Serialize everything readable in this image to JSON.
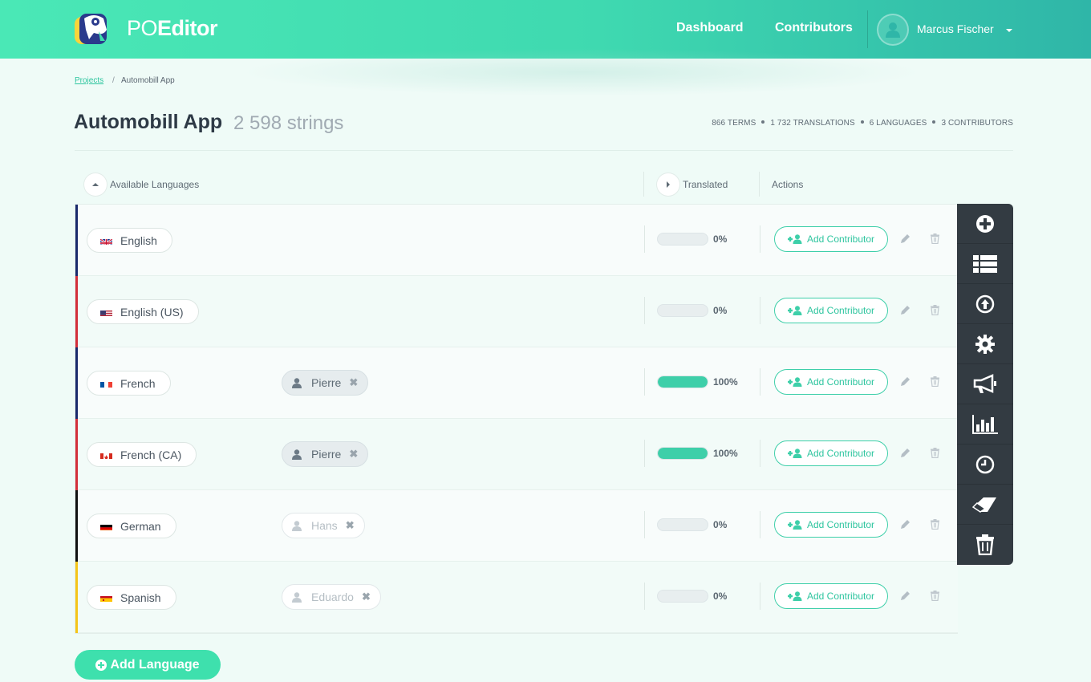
{
  "app": {
    "logo_light": "PO",
    "logo_bold": "Editor"
  },
  "nav": {
    "dashboard": "Dashboard",
    "contributors": "Contributors"
  },
  "user": {
    "name": "Marcus Fischer"
  },
  "breadcrumb": {
    "link": "Projects",
    "separator": "/",
    "current": "Automobill App"
  },
  "project": {
    "title": "Automobill App",
    "strings": "2 598 strings"
  },
  "stats": [
    "866 TERMS",
    "1 732 TRANSLATIONS",
    "6 LANGUAGES",
    "3 CONTRIBUTORS"
  ],
  "table": {
    "col_languages": "Available Languages",
    "col_translated": "Translated",
    "col_actions": "Actions"
  },
  "add_contributor_label": "Add Contributor",
  "add_language_label": "Add Language",
  "colors": {
    "accent": "#3ecfa9",
    "header_start": "#4ae8b6",
    "header_end": "#2fb6a8",
    "sidebar": "#333b42"
  },
  "languages": [
    {
      "name": "English",
      "flag": "flag-uk",
      "bar_color": "#1a2a6c",
      "contributor": null,
      "contributor_state": null,
      "progress": 0,
      "progress_label": "0%"
    },
    {
      "name": "English (US)",
      "flag": "flag-us",
      "bar_color": "#d32f3a",
      "contributor": null,
      "contributor_state": null,
      "progress": 0,
      "progress_label": "0%"
    },
    {
      "name": "French",
      "flag": "flag-fr",
      "bar_color": "#1a2a6c",
      "contributor": "Pierre",
      "contributor_state": "active",
      "progress": 100,
      "progress_label": "100%"
    },
    {
      "name": "French (CA)",
      "flag": "flag-ca",
      "bar_color": "#d32f3a",
      "contributor": "Pierre",
      "contributor_state": "active",
      "progress": 100,
      "progress_label": "100%"
    },
    {
      "name": "German",
      "flag": "flag-de",
      "bar_color": "#111111",
      "contributor": "Hans",
      "contributor_state": "pending",
      "progress": 0,
      "progress_label": "0%"
    },
    {
      "name": "Spanish",
      "flag": "flag-es",
      "bar_color": "#f5c518",
      "contributor": "Eduardo",
      "contributor_state": "pending",
      "progress": 0,
      "progress_label": "0%"
    }
  ],
  "tools": [
    "add-icon",
    "list-icon",
    "upload-icon",
    "settings-icon",
    "megaphone-icon",
    "chart-icon",
    "clock-icon",
    "eraser-icon",
    "trash-icon"
  ]
}
